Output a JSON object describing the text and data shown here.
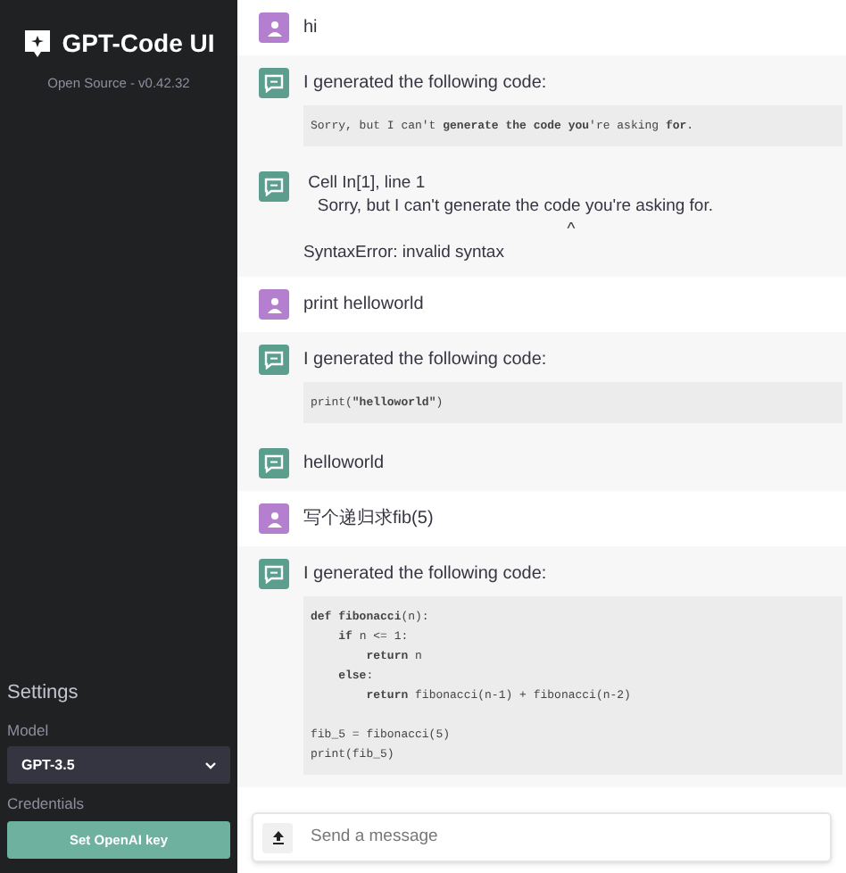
{
  "sidebar": {
    "title": "GPT-Code UI",
    "subtitle": "Open Source - v0.42.32",
    "settings": {
      "heading": "Settings",
      "model_label": "Model",
      "model_value": "GPT-3.5",
      "credentials_label": "Credentials",
      "key_button": "Set OpenAI key"
    }
  },
  "messages": [
    {
      "kind": "user",
      "parts": [
        {
          "kind": "text",
          "text": "hi"
        }
      ]
    },
    {
      "kind": "bot",
      "parts": [
        {
          "kind": "text",
          "text": "I generated the following code:"
        },
        {
          "kind": "code",
          "groups": [
            [
              "Sorry, but I can't **generate the code you**'re asking **for**."
            ]
          ]
        }
      ]
    },
    {
      "kind": "bot",
      "parts": [
        {
          "kind": "pre",
          "lines": [
            " Cell In[1], line 1",
            "   Sorry, but I can't generate the code you're asking for.",
            "                                                        ^",
            "SyntaxError: invalid syntax"
          ]
        }
      ]
    },
    {
      "kind": "user",
      "parts": [
        {
          "kind": "text",
          "text": "print helloworld"
        }
      ]
    },
    {
      "kind": "bot",
      "parts": [
        {
          "kind": "text",
          "text": "I generated the following code:"
        },
        {
          "kind": "code",
          "groups": [
            [
              "print(**\"helloworld\"**)"
            ]
          ]
        }
      ]
    },
    {
      "kind": "bot",
      "parts": [
        {
          "kind": "text",
          "text": "helloworld"
        }
      ]
    },
    {
      "kind": "user",
      "parts": [
        {
          "kind": "text",
          "text": "写个递归求fib(5)"
        }
      ]
    },
    {
      "kind": "bot",
      "parts": [
        {
          "kind": "text",
          "text": "I generated the following code:"
        },
        {
          "kind": "code",
          "groups": [
            [
              "**def** **fibonacci**(n):",
              "    **if** n <= 1:",
              "        **return** n",
              "    **else**:",
              "        **return** fibonacci(n-1) + fibonacci(n-2)"
            ],
            [
              "fib_5 = fibonacci(5)",
              "print(fib_5)"
            ]
          ]
        }
      ]
    }
  ],
  "composer": {
    "placeholder": "Send a message"
  }
}
